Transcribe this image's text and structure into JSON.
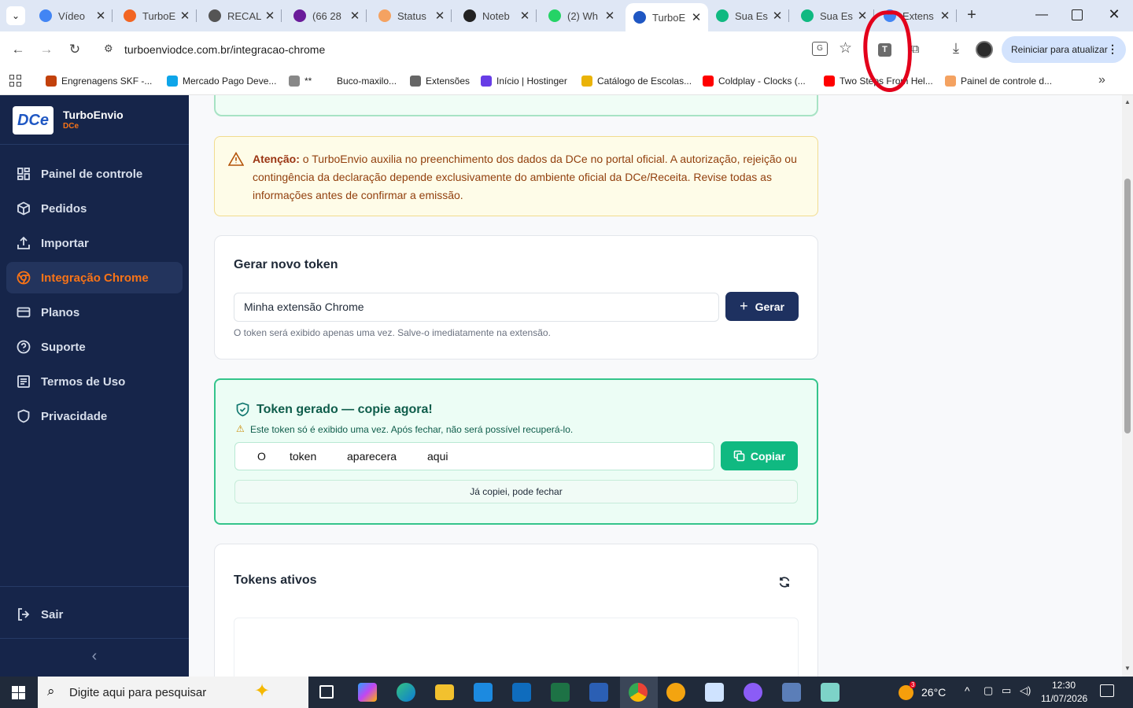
{
  "browser": {
    "tabs": [
      {
        "title": "Vídeo",
        "color": "#4285f4"
      },
      {
        "title": "TurboE",
        "color": "#f26522"
      },
      {
        "title": "RECAL",
        "color": "#555555"
      },
      {
        "title": "(66 28",
        "color": "#6a1b9a"
      },
      {
        "title": "Status",
        "color": "#f4a261"
      },
      {
        "title": "Noteb",
        "color": "#222222"
      },
      {
        "title": "(2) Wh",
        "color": "#25d366"
      },
      {
        "title": "TurboE",
        "color": "#1f57c3"
      },
      {
        "title": "Sua Es",
        "color": "#10b981"
      },
      {
        "title": "Sua Es",
        "color": "#10b981"
      },
      {
        "title": "Extens",
        "color": "#4285f4"
      }
    ],
    "url": "turboenviodce.com.br/integracao-chrome",
    "update_label": "Reiniciar para atualizar",
    "bookmarks": [
      {
        "label": "Engrenagens SKF -...",
        "color": "#c2410c"
      },
      {
        "label": "Mercado Pago Deve...",
        "color": "#0ea5e9"
      },
      {
        "label": "**",
        "color": "#888888"
      },
      {
        "label": "Buco-maxilo...",
        "color": "#ffffff"
      },
      {
        "label": "Extensões",
        "color": "#666666"
      },
      {
        "label": "Início | Hostinger",
        "color": "#673de6"
      },
      {
        "label": "Catálogo de Escolas...",
        "color": "#eab308"
      },
      {
        "label": "Coldplay - Clocks (...",
        "color": "#ff0000"
      },
      {
        "label": "Two Steps From Hel...",
        "color": "#ff0000"
      },
      {
        "label": "Painel de controle d...",
        "color": "#f4a261"
      }
    ]
  },
  "sidebar": {
    "logo_text": "DCe",
    "app_name": "TurboEnvio",
    "app_sub": "DCe",
    "items": [
      {
        "label": "Painel de controle",
        "icon": "grid-icon"
      },
      {
        "label": "Pedidos",
        "icon": "box-icon"
      },
      {
        "label": "Importar",
        "icon": "upload-icon"
      },
      {
        "label": "Integração Chrome",
        "icon": "chrome-icon"
      },
      {
        "label": "Planos",
        "icon": "card-icon"
      },
      {
        "label": "Suporte",
        "icon": "help-icon"
      },
      {
        "label": "Termos de Uso",
        "icon": "document-icon"
      },
      {
        "label": "Privacidade",
        "icon": "shield-icon"
      }
    ],
    "logout_label": "Sair",
    "collapse_glyph": "‹"
  },
  "alert": {
    "strong": "Atenção:",
    "text": " o TurboEnvio auxilia no preenchimento dos dados da DCe no portal oficial. A autorização, rejeição ou contingência da declaração depende exclusivamente do ambiente oficial da DCe/Receita. Revise todas as informações antes de confirmar a emissão."
  },
  "generate": {
    "title": "Gerar novo token",
    "input_value": "Minha extensão Chrome",
    "button_label": "Gerar",
    "hint": "O token será exibido apenas uma vez. Salve-o imediatamente na extensão."
  },
  "token": {
    "title": "Token gerado — copie agora!",
    "warning": "Este token só é exibido uma vez. Após fechar, não será possível recuperá-lo.",
    "words": [
      "O",
      "token",
      "aparecera",
      "aqui"
    ],
    "copy_label": "Copiar",
    "close_label": "Já copiei, pode fechar"
  },
  "tokens_list": {
    "title": "Tokens ativos"
  },
  "taskbar": {
    "search_placeholder": "Digite aqui para pesquisar",
    "weather": "26°C",
    "weather_badge": "3",
    "time": "12:30",
    "date": "11/07/2026"
  },
  "colors": {
    "sidebar_bg": "#16254a",
    "accent_orange": "#f97316",
    "primary_button": "#1e3160",
    "success_green": "#10b981",
    "alert_bg": "#fefce8",
    "annotation_red": "#e3001b"
  }
}
